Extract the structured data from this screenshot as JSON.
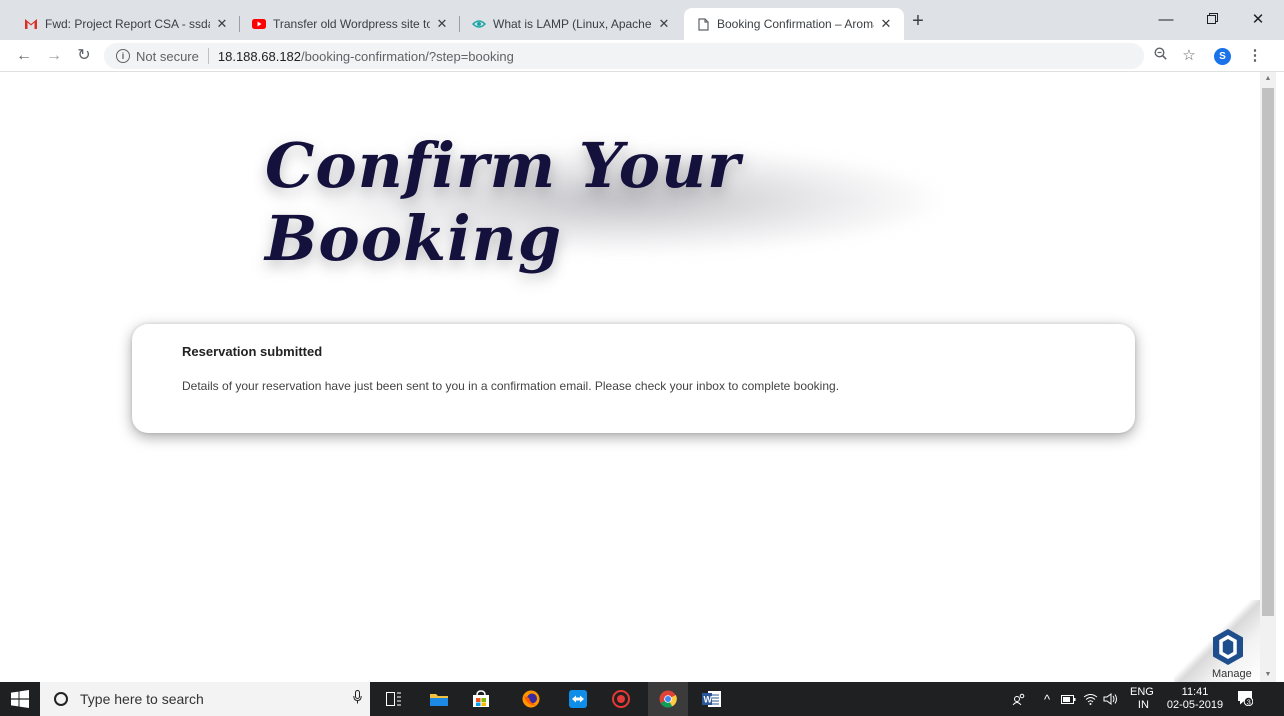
{
  "browser": {
    "tabs": [
      {
        "title": "Fwd: Project Report CSA - ssdave",
        "icon": "gmail-icon"
      },
      {
        "title": "Transfer old Wordpress site to ne",
        "icon": "youtube-icon"
      },
      {
        "title": "What is LAMP (Linux, Apache, My",
        "icon": "eye-icon"
      },
      {
        "title": "Booking Confirmation – Aroma H",
        "icon": "page-icon",
        "active": true
      }
    ],
    "close_glyph": "✕",
    "new_tab_glyph": "+",
    "url": {
      "security_label": "Not secure",
      "host": "18.188.68.182",
      "path": "/booking-confirmation/?step=booking"
    },
    "profile_initial": "S"
  },
  "page": {
    "heading": "Confirm Your Booking",
    "card": {
      "title": "Reservation submitted",
      "message": "Details of your reservation have just been sent to you in a confirmation email. Please check your inbox to complete booking."
    },
    "manage_label": "Manage"
  },
  "taskbar": {
    "search_placeholder": "Type here to search",
    "language": "ENG",
    "region": "IN",
    "time": "11:41",
    "date": "02-05-2019",
    "notification_count": "3"
  },
  "colors": {
    "heading": "#14123d",
    "tab_strip": "#dee1e6",
    "taskbar": "#1f2021",
    "profile": "#1a73e8"
  }
}
